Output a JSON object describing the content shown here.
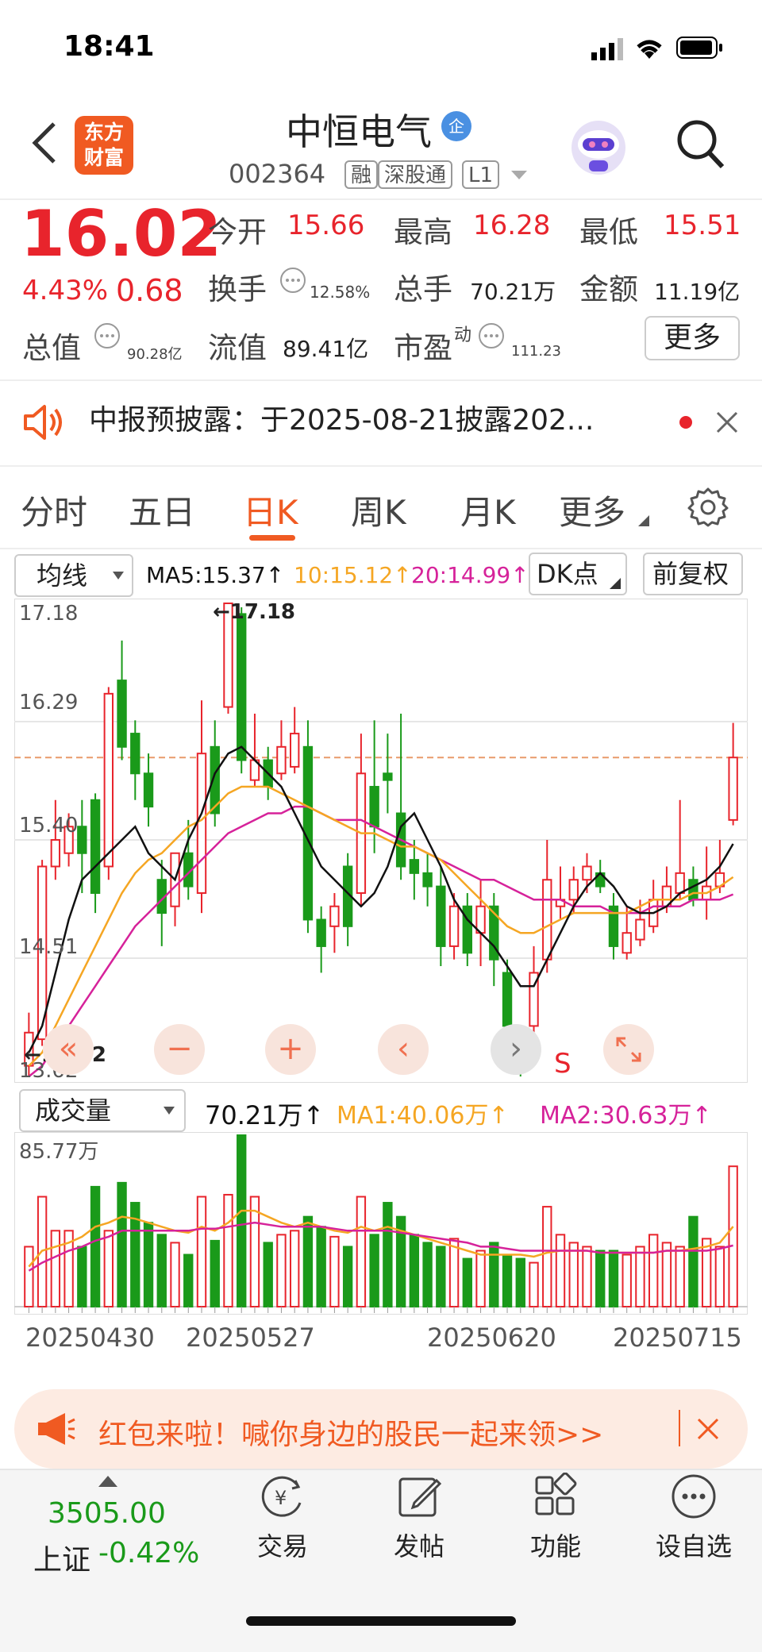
{
  "status_bar": {
    "time": "18:41"
  },
  "header": {
    "title": "中恒电气",
    "badge": "企",
    "code": "002364",
    "tags": [
      "融",
      "深股通",
      "L1"
    ],
    "logo": "东方财富"
  },
  "quote": {
    "price": "16.02",
    "change_pct": "4.43%",
    "change_amt": "0.68",
    "open_label": "今开",
    "open": "15.66",
    "high_label": "最高",
    "high": "16.28",
    "low_label": "最低",
    "low": "15.51",
    "turnover_label": "换手",
    "turnover": "12.58%",
    "volume_label": "总手",
    "volume": "70.21万",
    "amount_label": "金额",
    "amount": "11.19亿",
    "mktcap_label": "总值",
    "mktcap": "90.28亿",
    "float_label": "流值",
    "float": "89.41亿",
    "pe_label": "市盈",
    "pe_sup": "动",
    "pe": "111.23",
    "more_label": "更多"
  },
  "notice": {
    "text": "中报预披露：于2025-08-21披露202..."
  },
  "tabs": [
    "分时",
    "五日",
    "日K",
    "周K",
    "月K",
    "更多"
  ],
  "active_tab": "日K",
  "indicator": {
    "select": "均线",
    "ma5": "MA5:15.37↑",
    "ma10": "10:15.12↑",
    "ma20": "20:14.99↑",
    "dk": "DK点",
    "fq": "前复权"
  },
  "price_axis": {
    "top": "17.18",
    "l2": "16.29",
    "l3": "15.40",
    "l4": "14.51",
    "bottom": "13.62"
  },
  "markers": {
    "high": "←17.18",
    "low": "←13.62",
    "s": "S"
  },
  "volume_panel": {
    "select": "成交量",
    "value": "70.21万↑",
    "ma1": "MA1:40.06万↑",
    "ma2": "MA2:30.63万↑",
    "max": "85.77万"
  },
  "dates": [
    "20250430",
    "20250527",
    "20250620",
    "20250715"
  ],
  "banner": {
    "text": "红包来啦！喊你身边的股民一起来领>>"
  },
  "bottom_nav": {
    "index_value": "3505.00",
    "index_name": "上证",
    "index_change": "-0.42%",
    "items": [
      "交易",
      "发帖",
      "功能",
      "设自选"
    ]
  },
  "colors": {
    "up": "#e8242c",
    "down": "#1a9a1a",
    "accent": "#f05a22",
    "ma5": "#111111",
    "ma10": "#f5a623",
    "ma20": "#d6229a"
  },
  "chart_data": {
    "type": "candlestick",
    "ylim": [
      13.62,
      17.18
    ],
    "candles": [
      {
        "o": 13.7,
        "c": 13.95,
        "h": 14.1,
        "l": 13.62
      },
      {
        "o": 13.9,
        "c": 15.2,
        "h": 15.25,
        "l": 13.85
      },
      {
        "o": 15.2,
        "c": 15.4,
        "h": 15.7,
        "l": 15.1
      },
      {
        "o": 15.3,
        "c": 15.5,
        "h": 15.6,
        "l": 15.2
      },
      {
        "o": 15.5,
        "c": 15.3,
        "h": 15.7,
        "l": 15.0
      },
      {
        "o": 15.7,
        "c": 15.0,
        "h": 15.75,
        "l": 14.85
      },
      {
        "o": 15.2,
        "c": 16.5,
        "h": 16.55,
        "l": 15.1
      },
      {
        "o": 16.6,
        "c": 16.1,
        "h": 16.9,
        "l": 16.0
      },
      {
        "o": 16.2,
        "c": 15.9,
        "h": 16.3,
        "l": 15.7
      },
      {
        "o": 15.9,
        "c": 15.65,
        "h": 16.05,
        "l": 15.5
      },
      {
        "o": 15.1,
        "c": 14.85,
        "h": 15.25,
        "l": 14.6
      },
      {
        "o": 14.9,
        "c": 15.3,
        "h": 15.3,
        "l": 14.75
      },
      {
        "o": 15.3,
        "c": 15.05,
        "h": 15.55,
        "l": 14.95
      },
      {
        "o": 15.0,
        "c": 16.05,
        "h": 16.45,
        "l": 14.85
      },
      {
        "o": 16.1,
        "c": 15.6,
        "h": 16.3,
        "l": 15.5
      },
      {
        "o": 16.4,
        "c": 17.18,
        "h": 17.18,
        "l": 16.35
      },
      {
        "o": 17.1,
        "c": 16.0,
        "h": 17.15,
        "l": 15.9
      },
      {
        "o": 15.85,
        "c": 16.0,
        "h": 16.35,
        "l": 15.8
      },
      {
        "o": 16.0,
        "c": 15.8,
        "h": 16.1,
        "l": 15.7
      },
      {
        "o": 15.9,
        "c": 16.1,
        "h": 16.3,
        "l": 15.85
      },
      {
        "o": 15.95,
        "c": 16.2,
        "h": 16.4,
        "l": 15.9
      },
      {
        "o": 16.1,
        "c": 14.8,
        "h": 16.3,
        "l": 14.7
      },
      {
        "o": 14.8,
        "c": 14.6,
        "h": 14.9,
        "l": 14.4
      },
      {
        "o": 14.75,
        "c": 14.9,
        "h": 15.0,
        "l": 14.55
      },
      {
        "o": 15.2,
        "c": 14.75,
        "h": 15.3,
        "l": 14.6
      },
      {
        "o": 15.0,
        "c": 15.9,
        "h": 16.2,
        "l": 14.9
      },
      {
        "o": 15.8,
        "c": 15.5,
        "h": 16.3,
        "l": 15.3
      },
      {
        "o": 15.9,
        "c": 15.85,
        "h": 16.2,
        "l": 15.6
      },
      {
        "o": 15.6,
        "c": 15.2,
        "h": 16.35,
        "l": 15.1
      },
      {
        "o": 15.25,
        "c": 15.15,
        "h": 15.4,
        "l": 14.95
      },
      {
        "o": 15.15,
        "c": 15.05,
        "h": 15.3,
        "l": 14.9
      },
      {
        "o": 15.05,
        "c": 14.6,
        "h": 15.2,
        "l": 14.45
      },
      {
        "o": 14.6,
        "c": 14.9,
        "h": 15.0,
        "l": 14.5
      },
      {
        "o": 14.9,
        "c": 14.55,
        "h": 15.0,
        "l": 14.45
      },
      {
        "o": 14.7,
        "c": 14.9,
        "h": 15.1,
        "l": 14.45
      },
      {
        "o": 14.9,
        "c": 14.5,
        "h": 15.0,
        "l": 14.3
      },
      {
        "o": 14.4,
        "c": 14.0,
        "h": 14.5,
        "l": 13.9
      },
      {
        "o": 13.9,
        "c": 13.7,
        "h": 14.0,
        "l": 13.62
      },
      {
        "o": 14.0,
        "c": 14.4,
        "h": 14.6,
        "l": 13.95
      },
      {
        "o": 14.5,
        "c": 15.1,
        "h": 15.4,
        "l": 14.4
      },
      {
        "o": 14.9,
        "c": 14.95,
        "h": 15.2,
        "l": 14.8
      },
      {
        "o": 14.95,
        "c": 15.1,
        "h": 15.2,
        "l": 14.85
      },
      {
        "o": 15.1,
        "c": 15.2,
        "h": 15.3,
        "l": 15.0
      },
      {
        "o": 15.15,
        "c": 15.05,
        "h": 15.25,
        "l": 15.0
      },
      {
        "o": 14.9,
        "c": 14.6,
        "h": 15.0,
        "l": 14.5
      },
      {
        "o": 14.55,
        "c": 14.7,
        "h": 14.9,
        "l": 14.5
      },
      {
        "o": 14.65,
        "c": 14.8,
        "h": 14.95,
        "l": 14.6
      },
      {
        "o": 14.75,
        "c": 14.95,
        "h": 15.1,
        "l": 14.7
      },
      {
        "o": 14.9,
        "c": 15.05,
        "h": 15.2,
        "l": 14.85
      },
      {
        "o": 15.0,
        "c": 15.15,
        "h": 15.7,
        "l": 14.95
      },
      {
        "o": 15.1,
        "c": 14.95,
        "h": 15.2,
        "l": 14.9
      },
      {
        "o": 14.95,
        "c": 15.05,
        "h": 15.35,
        "l": 14.8
      },
      {
        "o": 15.05,
        "c": 15.15,
        "h": 15.4,
        "l": 15.0
      },
      {
        "o": 15.55,
        "c": 16.02,
        "h": 16.28,
        "l": 15.51
      }
    ],
    "ma5": [
      13.8,
      14.0,
      14.4,
      14.8,
      15.1,
      15.2,
      15.3,
      15.4,
      15.5,
      15.3,
      15.2,
      15.1,
      15.4,
      15.6,
      15.9,
      16.05,
      16.1,
      16.0,
      15.9,
      15.8,
      15.6,
      15.4,
      15.2,
      15.1,
      15.0,
      14.9,
      15.0,
      15.2,
      15.5,
      15.6,
      15.4,
      15.2,
      14.95,
      14.8,
      14.7,
      14.6,
      14.45,
      14.3,
      14.3,
      14.5,
      14.7,
      14.9,
      15.05,
      15.15,
      15.05,
      14.9,
      14.85,
      14.85,
      14.9,
      15.0,
      15.05,
      15.1,
      15.2,
      15.37
    ],
    "ma10": [
      13.7,
      13.8,
      14.0,
      14.2,
      14.4,
      14.6,
      14.8,
      15.0,
      15.15,
      15.25,
      15.3,
      15.4,
      15.5,
      15.55,
      15.65,
      15.75,
      15.8,
      15.8,
      15.8,
      15.75,
      15.7,
      15.65,
      15.6,
      15.55,
      15.5,
      15.45,
      15.45,
      15.4,
      15.35,
      15.35,
      15.3,
      15.25,
      15.15,
      15.05,
      14.95,
      14.85,
      14.75,
      14.7,
      14.7,
      14.75,
      14.8,
      14.85,
      14.85,
      14.85,
      14.85,
      14.85,
      14.9,
      14.95,
      14.95,
      14.95,
      15.0,
      15.0,
      15.05,
      15.12
    ],
    "ma20": [
      13.62,
      13.7,
      13.85,
      14.0,
      14.15,
      14.3,
      14.45,
      14.6,
      14.75,
      14.85,
      14.95,
      15.05,
      15.15,
      15.25,
      15.35,
      15.45,
      15.5,
      15.55,
      15.6,
      15.6,
      15.65,
      15.65,
      15.6,
      15.55,
      15.55,
      15.55,
      15.5,
      15.45,
      15.4,
      15.35,
      15.3,
      15.25,
      15.2,
      15.15,
      15.1,
      15.1,
      15.05,
      15.0,
      14.95,
      14.95,
      14.95,
      14.9,
      14.9,
      14.9,
      14.85,
      14.85,
      14.85,
      14.9,
      14.9,
      14.9,
      14.95,
      14.95,
      14.95,
      14.99
    ],
    "volume": {
      "max": 85.77,
      "values": [
        30,
        55,
        38,
        38,
        30,
        60,
        38,
        62,
        52,
        42,
        36,
        32,
        26,
        55,
        33,
        56,
        85.77,
        55,
        32,
        36,
        38,
        45,
        40,
        35,
        30,
        55,
        36,
        52,
        45,
        36,
        32,
        30,
        34,
        24,
        28,
        32,
        26,
        24,
        22,
        50,
        36,
        32,
        30,
        28,
        28,
        26,
        30,
        36,
        32,
        30,
        45,
        34,
        30,
        70.21
      ],
      "ma1": [
        20,
        28,
        30,
        32,
        35,
        40,
        42,
        45,
        44,
        42,
        40,
        38,
        37,
        40,
        38,
        42,
        48,
        48,
        45,
        42,
        40,
        42,
        40,
        38,
        37,
        40,
        38,
        40,
        38,
        36,
        34,
        32,
        30,
        28,
        26,
        26,
        26,
        26,
        25,
        27,
        28,
        28,
        28,
        27,
        27,
        27,
        27,
        27,
        28,
        28,
        29,
        30,
        32,
        40.06
      ],
      "ma2": [
        18,
        22,
        25,
        28,
        30,
        33,
        35,
        38,
        38,
        38,
        38,
        38,
        38,
        39,
        39,
        40,
        41,
        42,
        41,
        40,
        40,
        40,
        40,
        39,
        38,
        38,
        38,
        38,
        37,
        36,
        35,
        34,
        33,
        32,
        30,
        30,
        29,
        28,
        28,
        28,
        28,
        28,
        28,
        27,
        27,
        27,
        27,
        27,
        28,
        28,
        28,
        28,
        29,
        30.63
      ]
    }
  }
}
